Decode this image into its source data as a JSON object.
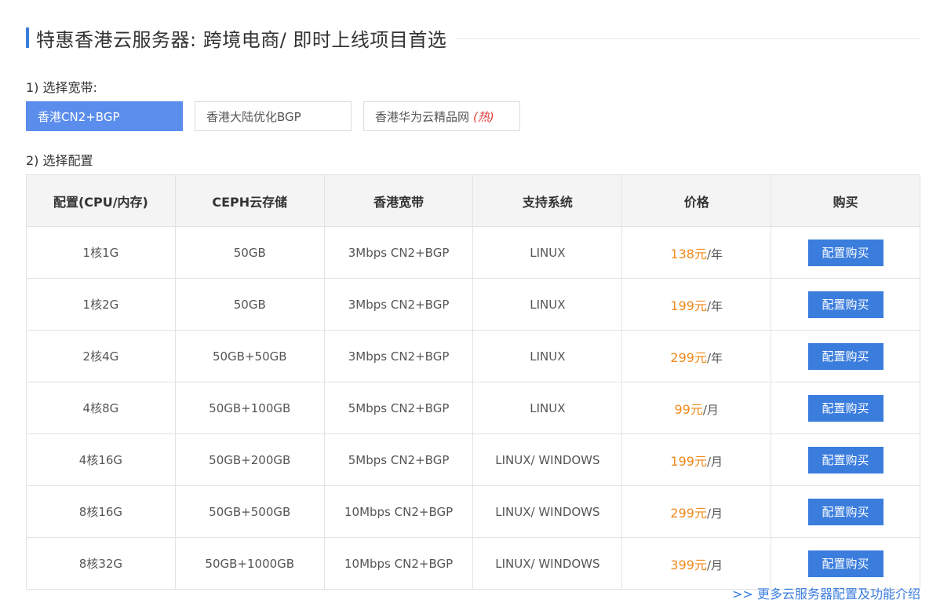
{
  "title": "特惠香港云服务器: 跨境电商/ 即时上线项目首选",
  "step1_label": "1) 选择宽带:",
  "bandwidth_tabs": [
    {
      "label": "香港CN2+BGP",
      "active": true
    },
    {
      "label": "香港大陆优化BGP",
      "active": false
    },
    {
      "label": "香港华为云精品网",
      "hot": "(热)",
      "active": false
    }
  ],
  "step2_label": "2) 选择配置",
  "table": {
    "headers": [
      "配置(CPU/内存)",
      "CEPH云存储",
      "香港宽带",
      "支持系统",
      "价格",
      "购买"
    ],
    "rows": [
      {
        "cpu_mem": "1核1G",
        "storage": "50GB",
        "bandwidth": "3Mbps CN2+BGP",
        "os": "LINUX",
        "price": "138元",
        "period": "/年",
        "buy": "配置购买"
      },
      {
        "cpu_mem": "1核2G",
        "storage": "50GB",
        "bandwidth": "3Mbps CN2+BGP",
        "os": "LINUX",
        "price": "199元",
        "period": "/年",
        "buy": "配置购买"
      },
      {
        "cpu_mem": "2核4G",
        "storage": "50GB+50GB",
        "bandwidth": "3Mbps CN2+BGP",
        "os": "LINUX",
        "price": "299元",
        "period": "/年",
        "buy": "配置购买"
      },
      {
        "cpu_mem": "4核8G",
        "storage": "50GB+100GB",
        "bandwidth": "5Mbps CN2+BGP",
        "os": "LINUX",
        "price": "99元",
        "period": "/月",
        "buy": "配置购买"
      },
      {
        "cpu_mem": "4核16G",
        "storage": "50GB+200GB",
        "bandwidth": "5Mbps CN2+BGP",
        "os": "LINUX/ WINDOWS",
        "price": "199元",
        "period": "/月",
        "buy": "配置购买"
      },
      {
        "cpu_mem": "8核16G",
        "storage": "50GB+500GB",
        "bandwidth": "10Mbps CN2+BGP",
        "os": "LINUX/ WINDOWS",
        "price": "299元",
        "period": "/月",
        "buy": "配置购买"
      },
      {
        "cpu_mem": "8核32G",
        "storage": "50GB+1000GB",
        "bandwidth": "10Mbps CN2+BGP",
        "os": "LINUX/ WINDOWS",
        "price": "399元",
        "period": "/月",
        "buy": "配置购买"
      }
    ]
  },
  "more_link": ">> 更多云服务器配置及功能介绍",
  "colors": {
    "accent": "#3b7ddd",
    "active_tab": "#5b8ded",
    "price": "#f08a1c",
    "hot": "#e23b3b"
  }
}
